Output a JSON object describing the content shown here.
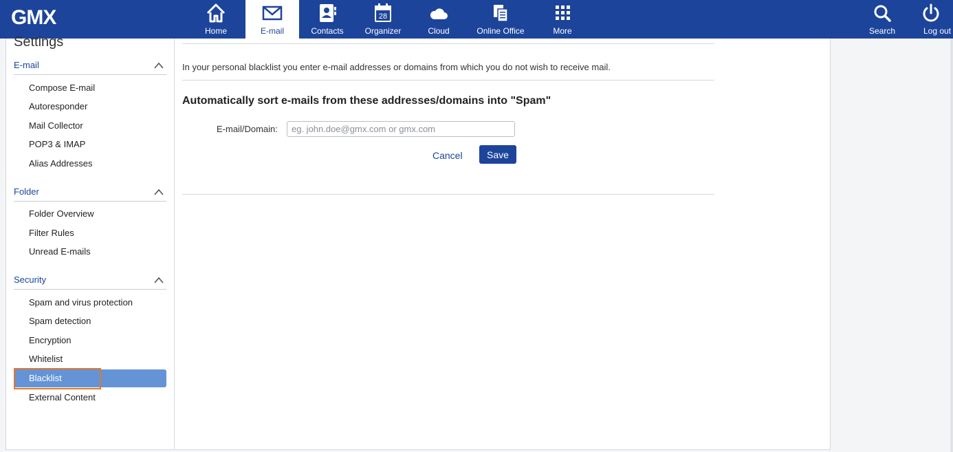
{
  "brand": {
    "logo": "GMX"
  },
  "nav": {
    "items": [
      {
        "label": "Home",
        "icon": "home-icon"
      },
      {
        "label": "E-mail",
        "icon": "envelope-icon",
        "active": true
      },
      {
        "label": "Contacts",
        "icon": "contacts-icon"
      },
      {
        "label": "Organizer",
        "icon": "calendar-icon",
        "badge": "28"
      },
      {
        "label": "Cloud",
        "icon": "cloud-icon"
      },
      {
        "label": "Online Office",
        "icon": "documents-icon"
      },
      {
        "label": "More",
        "icon": "grid-icon"
      }
    ],
    "right": [
      {
        "label": "Search",
        "icon": "search-icon"
      },
      {
        "label": "Log out",
        "icon": "power-icon"
      }
    ]
  },
  "colors": {
    "brand": "#1c449b",
    "active_item": "#6494d6",
    "highlight": "#e0782a"
  },
  "sidebar": {
    "title": "Settings",
    "sections": [
      {
        "label": "E-mail",
        "items": [
          "Compose E-mail",
          "Autoresponder",
          "Mail Collector",
          "POP3 & IMAP",
          "Alias Addresses"
        ]
      },
      {
        "label": "Folder",
        "items": [
          "Folder Overview",
          "Filter Rules",
          "Unread E-mails"
        ]
      },
      {
        "label": "Security",
        "items": [
          "Spam and virus protection",
          "Spam detection",
          "Encryption",
          "Whitelist",
          "Blacklist",
          "External Content"
        ]
      }
    ],
    "active_item": "Blacklist"
  },
  "main": {
    "intro": "In your personal blacklist you enter e-mail addresses or domains from which you do not wish to receive mail.",
    "heading": "Automatically sort e-mails from these addresses/domains into \"Spam\"",
    "field_label": "E-mail/Domain:",
    "field_placeholder": "eg. john.doe@gmx.com or gmx.com",
    "field_value": "",
    "cancel_label": "Cancel",
    "save_label": "Save"
  }
}
